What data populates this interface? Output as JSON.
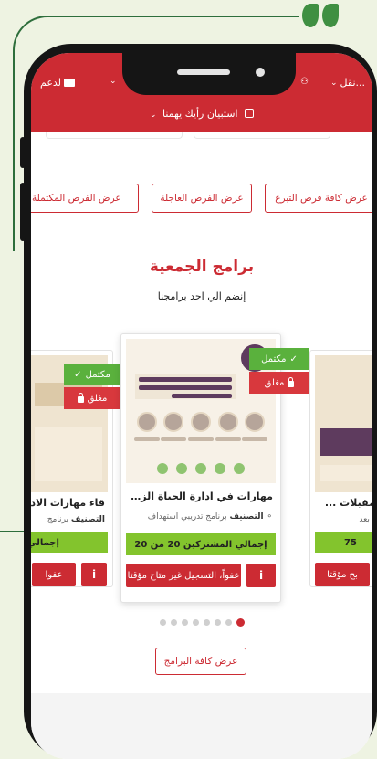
{
  "topbar": {
    "items": [
      {
        "label": "...نقل",
        "icon": "chevron-down-icon"
      },
      {
        "label": "",
        "icon": "users-icon"
      },
      {
        "label": "لدعم",
        "icon": "mail-icon"
      }
    ],
    "survey": "استبيان رأيك يهمنا",
    "survey_chevron": "chevron-down-icon"
  },
  "opportunities": {
    "buttons": [
      "عرض كافة فرص التبرع",
      "عرض الفرص العاجلة",
      "عرض الفرص المكتملة"
    ]
  },
  "programs": {
    "title": "برامج الجمعية",
    "subtitle": "إنضم الي احد برامجنا",
    "view_all": "عرض كافة البرامج",
    "slider_dots": 7,
    "active_dot": 0,
    "main_card": {
      "status_complete": "مكتمل",
      "status_closed": "مغلق",
      "title": "مهارات في ادارة الحياة الزوجية للمقبلين علـ...",
      "category_label": "التصنيف",
      "category_value": "برنامج تدريبي استهداف",
      "participants": "إجمالي المشتركين 20 من 20",
      "info": "i",
      "closed_registration": "عفواً، التسجيل غير متاح مؤقتا"
    },
    "left_card": {
      "status_complete": "مكتمل",
      "status_closed": "مغلق",
      "title": "قاء مهارات الاد",
      "category_label": "التصنيف",
      "category_value": "برنامج",
      "participants": "إجمالي",
      "info": "i",
      "closed_registration": "عفوا"
    },
    "right_card": {
      "title": "للمقبلات ...",
      "category_value": "عن بعد",
      "participants": "75",
      "closed_registration": "بح مؤقتا"
    }
  },
  "colors": {
    "brand_red": "#cc2b33",
    "green": "#5ab13d",
    "participants_green": "#83c42d",
    "background": "#eef3e2"
  }
}
